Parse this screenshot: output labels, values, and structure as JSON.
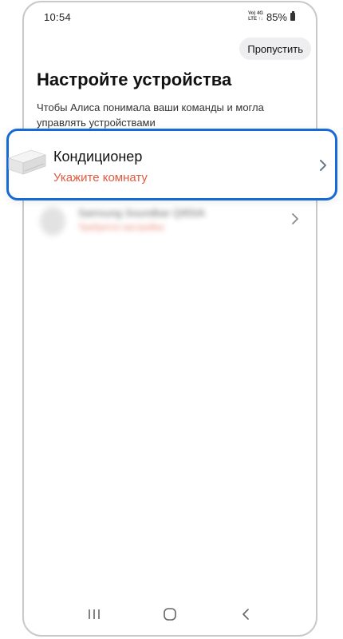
{
  "status_bar": {
    "time": "10:54",
    "network_top": "Vo) 4G",
    "network_bottom": "LTE ↑↓",
    "battery": "85%"
  },
  "header": {
    "skip_label": "Пропустить",
    "title": "Настройте устройства",
    "subtitle": "Чтобы Алиса понимала ваши команды и могла управлять устройствами"
  },
  "devices": [
    {
      "name": "Кондиционер",
      "status": "Укажите комнату",
      "status_color": "#e2593f",
      "icon": "air-conditioner-icon",
      "highlighted": true
    },
    {
      "name": "Samsung Soundbar Q950A",
      "status": "Требуется настройка",
      "status_color": "#e2593f",
      "icon": "soundbar-icon",
      "blurred": true
    }
  ],
  "highlight_color": "#1769d6",
  "nav": {
    "recents": "recents-icon",
    "home": "home-icon",
    "back": "back-icon"
  }
}
